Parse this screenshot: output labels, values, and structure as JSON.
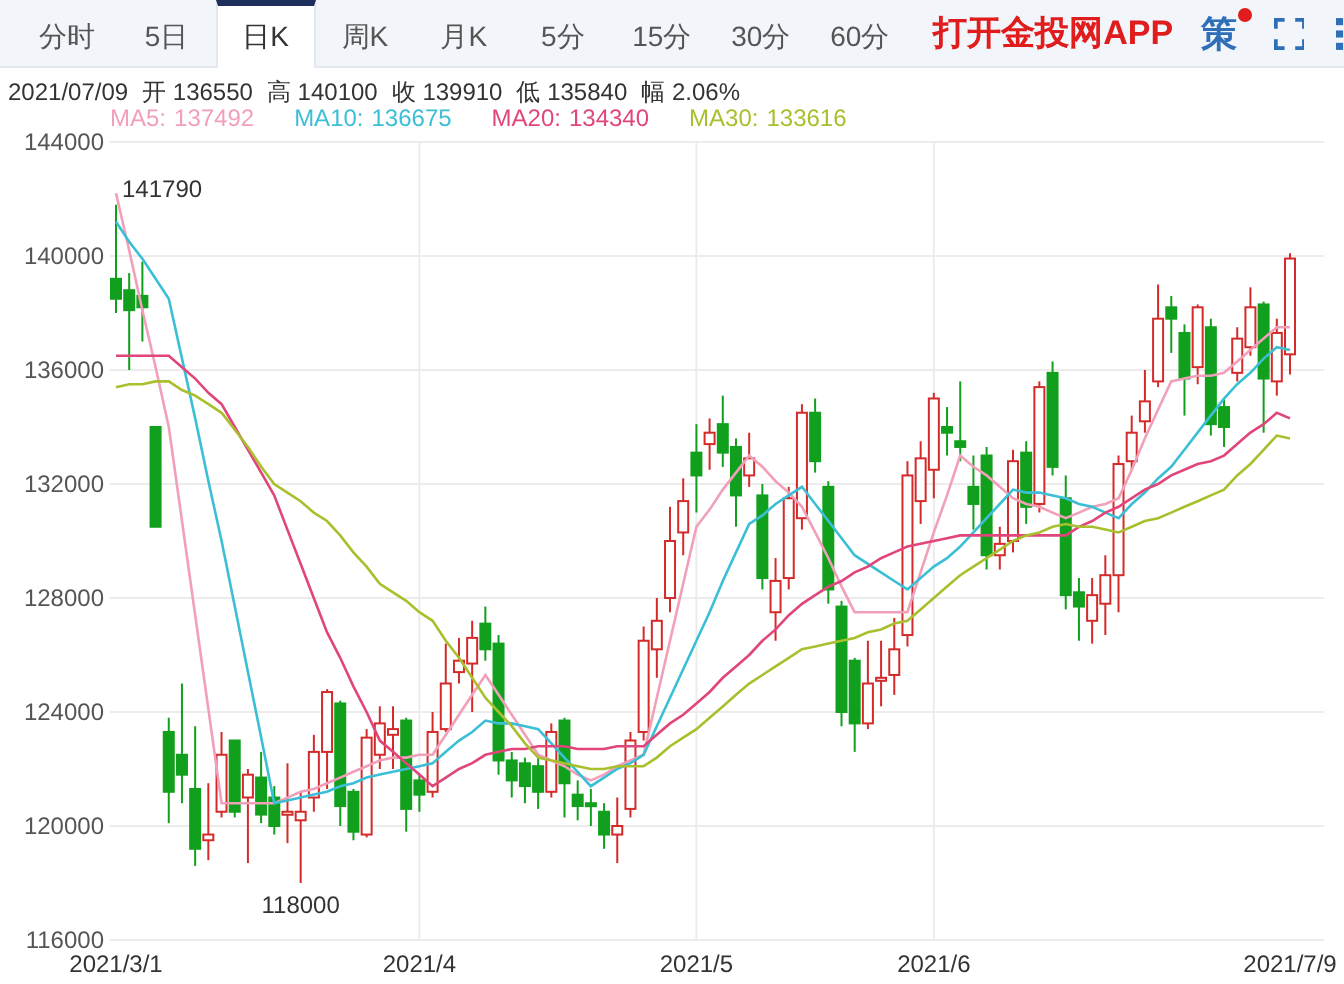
{
  "tabs": [
    {
      "label": "分时",
      "selected": false
    },
    {
      "label": "5日",
      "selected": false
    },
    {
      "label": "日K",
      "selected": true
    },
    {
      "label": "周K",
      "selected": false
    },
    {
      "label": "月K",
      "selected": false
    },
    {
      "label": "5分",
      "selected": false
    },
    {
      "label": "15分",
      "selected": false
    },
    {
      "label": "30分",
      "selected": false
    },
    {
      "label": "60分",
      "selected": false
    }
  ],
  "header_actions": {
    "app_link": "打开金投网APP",
    "strategy": {
      "label": "策",
      "has_notification": true
    }
  },
  "quote": {
    "date": "2021/07/09",
    "fields": [
      {
        "label": "开",
        "value": "136550"
      },
      {
        "label": "高",
        "value": "140100"
      },
      {
        "label": "收",
        "value": "139910"
      },
      {
        "label": "低",
        "value": "135840"
      },
      {
        "label": "幅",
        "value": "2.06%"
      }
    ]
  },
  "legend": [
    {
      "value": "137492"
    },
    {
      "value": "136675"
    },
    {
      "value": "134340"
    },
    {
      "value": "133616"
    }
  ],
  "chart": {
    "chart_data": {
      "type": "candlestick",
      "categories": [
        "2021/3/1",
        null,
        null,
        null,
        null,
        null,
        null,
        null,
        null,
        null,
        null,
        null,
        null,
        null,
        null,
        null,
        null,
        null,
        null,
        null,
        null,
        null,
        null,
        "2021/4",
        null,
        null,
        null,
        null,
        null,
        null,
        null,
        null,
        null,
        null,
        null,
        null,
        null,
        null,
        null,
        null,
        null,
        null,
        null,
        null,
        "2021/5",
        null,
        null,
        null,
        null,
        null,
        null,
        null,
        null,
        null,
        null,
        null,
        null,
        null,
        null,
        null,
        null,
        null,
        "2021/6",
        null,
        null,
        null,
        null,
        null,
        null,
        null,
        null,
        null,
        null,
        null,
        null,
        null,
        null,
        null,
        null,
        null,
        null,
        null,
        null,
        null,
        null,
        null,
        null,
        null,
        null,
        "2021/7/9"
      ],
      "ohlc": [
        [
          139200,
          141800,
          138000,
          138500
        ],
        [
          138800,
          139400,
          136000,
          138100
        ],
        [
          138600,
          139800,
          137000,
          138200
        ],
        [
          134000,
          134000,
          130500,
          130500
        ],
        [
          123300,
          123800,
          120100,
          121200
        ],
        [
          122500,
          125000,
          120800,
          121800
        ],
        [
          121300,
          123500,
          118600,
          119200
        ],
        [
          119500,
          121500,
          118800,
          119700
        ],
        [
          120500,
          123300,
          120300,
          122500
        ],
        [
          123000,
          123000,
          120300,
          120500
        ],
        [
          121000,
          122000,
          118700,
          121800
        ],
        [
          121700,
          122600,
          120100,
          120400
        ],
        [
          121000,
          121400,
          119700,
          120000
        ],
        [
          120400,
          122200,
          119400,
          120500
        ],
        [
          120200,
          121200,
          118000,
          120500
        ],
        [
          121000,
          123200,
          120500,
          122600
        ],
        [
          122600,
          124800,
          121300,
          124700
        ],
        [
          124300,
          124400,
          120000,
          120700
        ],
        [
          121200,
          121300,
          119500,
          119800
        ],
        [
          119700,
          123400,
          119600,
          123100
        ],
        [
          122500,
          124200,
          122000,
          123600
        ],
        [
          123200,
          124200,
          122000,
          123400
        ],
        [
          123700,
          123800,
          119800,
          120600
        ],
        [
          121600,
          121800,
          120500,
          121100
        ],
        [
          121200,
          124000,
          121000,
          123300
        ],
        [
          123400,
          126400,
          123300,
          125000
        ],
        [
          125400,
          126600,
          125000,
          125800
        ],
        [
          125700,
          127200,
          124000,
          126600
        ],
        [
          127100,
          127700,
          125800,
          126200
        ],
        [
          126400,
          126700,
          121800,
          122300
        ],
        [
          122300,
          122600,
          121000,
          121600
        ],
        [
          122200,
          122400,
          120800,
          121400
        ],
        [
          122100,
          122400,
          120600,
          121200
        ],
        [
          121200,
          123600,
          121000,
          123300
        ],
        [
          123700,
          123800,
          120300,
          121500
        ],
        [
          121100,
          121600,
          120200,
          120700
        ],
        [
          120800,
          121300,
          120000,
          120700
        ],
        [
          120500,
          120800,
          119200,
          119700
        ],
        [
          119700,
          121000,
          118700,
          120000
        ],
        [
          120600,
          123300,
          120300,
          123000
        ],
        [
          123300,
          127000,
          123000,
          126500
        ],
        [
          126200,
          128000,
          125200,
          127200
        ],
        [
          128000,
          131200,
          127500,
          130000
        ],
        [
          130300,
          132200,
          129500,
          131400
        ],
        [
          133100,
          134100,
          131000,
          132300
        ],
        [
          133400,
          134300,
          132500,
          133800
        ],
        [
          134100,
          135100,
          132600,
          133100
        ],
        [
          133300,
          133600,
          130500,
          131600
        ],
        [
          132300,
          133800,
          131900,
          132900
        ],
        [
          131600,
          132000,
          128300,
          128700
        ],
        [
          127500,
          129400,
          126500,
          128600
        ],
        [
          128700,
          131900,
          128300,
          131500
        ],
        [
          130800,
          134800,
          130400,
          134500
        ],
        [
          134500,
          135000,
          132400,
          132800
        ],
        [
          131900,
          132100,
          127800,
          128300
        ],
        [
          127700,
          127900,
          123500,
          124000
        ],
        [
          125800,
          125900,
          122600,
          123600
        ],
        [
          123600,
          126500,
          123400,
          125000
        ],
        [
          125100,
          126500,
          124200,
          125200
        ],
        [
          125300,
          127300,
          124600,
          126200
        ],
        [
          126700,
          132800,
          126300,
          132300
        ],
        [
          131400,
          133500,
          130600,
          132900
        ],
        [
          132500,
          135200,
          131500,
          135000
        ],
        [
          134000,
          134700,
          133000,
          133800
        ],
        [
          133500,
          135600,
          132800,
          133300
        ],
        [
          131900,
          133000,
          130400,
          131300
        ],
        [
          133000,
          133300,
          129000,
          129500
        ],
        [
          129500,
          130500,
          129000,
          129900
        ],
        [
          130000,
          133200,
          129600,
          132800
        ],
        [
          133100,
          133500,
          130600,
          131200
        ],
        [
          131300,
          135600,
          131000,
          135400
        ],
        [
          135900,
          136300,
          132300,
          132600
        ],
        [
          131500,
          132300,
          127600,
          128100
        ],
        [
          128200,
          128700,
          126500,
          127700
        ],
        [
          127200,
          128700,
          126400,
          128100
        ],
        [
          127800,
          129500,
          126700,
          128800
        ],
        [
          128800,
          133000,
          127500,
          132700
        ],
        [
          132800,
          134400,
          132500,
          133800
        ],
        [
          134200,
          136000,
          133800,
          134900
        ],
        [
          135600,
          139000,
          135400,
          137800
        ],
        [
          138200,
          138600,
          136600,
          137800
        ],
        [
          137300,
          137600,
          134400,
          135700
        ],
        [
          136100,
          138300,
          135500,
          138200
        ],
        [
          137500,
          137800,
          133700,
          134100
        ],
        [
          134700,
          135000,
          133300,
          134000
        ],
        [
          135900,
          137500,
          135600,
          137100
        ],
        [
          136800,
          138900,
          136500,
          138200
        ],
        [
          138300,
          138400,
          133800,
          135700
        ],
        [
          135600,
          137800,
          135100,
          137300
        ],
        [
          136550,
          140100,
          135840,
          139910
        ]
      ],
      "series": [
        {
          "name": "MA5:",
          "type": "line",
          "color": "#f29fb9",
          "values": [
            142200,
            140200,
            138100,
            136100,
            134000,
            130700,
            127400,
            124100,
            120800,
            120800,
            120800,
            120800,
            120800,
            121000,
            121200,
            121300,
            121500,
            121700,
            121900,
            122100,
            122300,
            122400,
            122400,
            122500,
            122500,
            123200,
            123900,
            124600,
            125300,
            124600,
            123900,
            123200,
            122500,
            122300,
            122100,
            121800,
            121600,
            121800,
            122100,
            122300,
            122500,
            124500,
            126500,
            128500,
            130500,
            131100,
            131800,
            132400,
            133000,
            132600,
            132100,
            131700,
            131200,
            130300,
            129400,
            128400,
            127500,
            127500,
            127500,
            127500,
            127500,
            128900,
            130300,
            131600,
            133000,
            132600,
            132300,
            131900,
            131500,
            131300,
            131200,
            131000,
            130800,
            131000,
            131200,
            131300,
            131500,
            132500,
            133600,
            134600,
            135600,
            135700,
            135800,
            135800,
            135900,
            136300,
            136700,
            137100,
            137500,
            137500
          ]
        },
        {
          "name": "MA10:",
          "type": "line",
          "color": "#3bbfd6",
          "values": [
            141200,
            140500,
            139900,
            139200,
            138500,
            136400,
            134300,
            132100,
            130000,
            127700,
            125400,
            123100,
            120800,
            120900,
            121000,
            121100,
            121200,
            121400,
            121500,
            121700,
            121800,
            121900,
            122000,
            122100,
            122200,
            122600,
            123000,
            123300,
            123700,
            123600,
            123600,
            123500,
            123400,
            122900,
            122400,
            121900,
            121400,
            121700,
            122000,
            122200,
            122500,
            123500,
            124500,
            125500,
            126500,
            127500,
            128600,
            129600,
            130600,
            130900,
            131300,
            131600,
            131900,
            131300,
            130700,
            130100,
            129500,
            129200,
            128900,
            128600,
            128300,
            128700,
            129100,
            129400,
            129800,
            130300,
            130800,
            131300,
            131800,
            131700,
            131700,
            131600,
            131500,
            131300,
            131200,
            131000,
            130800,
            131300,
            131700,
            132200,
            132600,
            133200,
            133800,
            134400,
            135000,
            135500,
            135900,
            136400,
            136800,
            136700
          ]
        },
        {
          "name": "MA20:",
          "type": "line",
          "color": "#e0457b",
          "values": [
            136500,
            136500,
            136500,
            136500,
            136500,
            136100,
            135700,
            135200,
            134800,
            134000,
            133200,
            132400,
            131600,
            130400,
            129200,
            128000,
            126800,
            125900,
            124900,
            124000,
            123000,
            122600,
            122200,
            121800,
            121400,
            121700,
            122000,
            122200,
            122500,
            122600,
            122700,
            122700,
            122800,
            122800,
            122800,
            122700,
            122700,
            122700,
            122800,
            122800,
            122800,
            123200,
            123600,
            123900,
            124300,
            124700,
            125200,
            125600,
            126000,
            126500,
            126900,
            127400,
            127800,
            128100,
            128400,
            128600,
            128900,
            129100,
            129400,
            129600,
            129800,
            129900,
            130000,
            130100,
            130200,
            130200,
            130200,
            130200,
            130200,
            130200,
            130200,
            130200,
            130200,
            130500,
            130700,
            131000,
            131200,
            131500,
            131800,
            132000,
            132300,
            132500,
            132700,
            132800,
            133000,
            133400,
            133800,
            134100,
            134500,
            134300
          ]
        },
        {
          "name": "MA30:",
          "type": "line",
          "color": "#a9bf2e",
          "values": [
            135400,
            135500,
            135500,
            135600,
            135600,
            135300,
            135100,
            134800,
            134500,
            133900,
            133300,
            132600,
            132000,
            131700,
            131400,
            131000,
            130700,
            130200,
            129600,
            129100,
            128500,
            128200,
            127900,
            127500,
            127200,
            126500,
            125900,
            125200,
            124500,
            124000,
            123500,
            122900,
            122400,
            122300,
            122200,
            122100,
            122000,
            122000,
            122100,
            122100,
            122100,
            122400,
            122800,
            123100,
            123400,
            123800,
            124200,
            124600,
            125000,
            125300,
            125600,
            125900,
            126200,
            126300,
            126400,
            126500,
            126600,
            126800,
            126900,
            127100,
            127200,
            127600,
            128000,
            128400,
            128800,
            129100,
            129400,
            129700,
            130000,
            130200,
            130300,
            130500,
            130600,
            130500,
            130500,
            130400,
            130300,
            130500,
            130700,
            130800,
            131000,
            131200,
            131400,
            131600,
            131800,
            132300,
            132700,
            133200,
            133700,
            133600
          ]
        }
      ],
      "grid": true,
      "ylim": [
        116000,
        144000
      ],
      "yticks": [
        116000,
        120000,
        124000,
        128000,
        132000,
        136000,
        140000,
        144000
      ],
      "annotations": [
        "141790",
        "118000"
      ]
    }
  }
}
